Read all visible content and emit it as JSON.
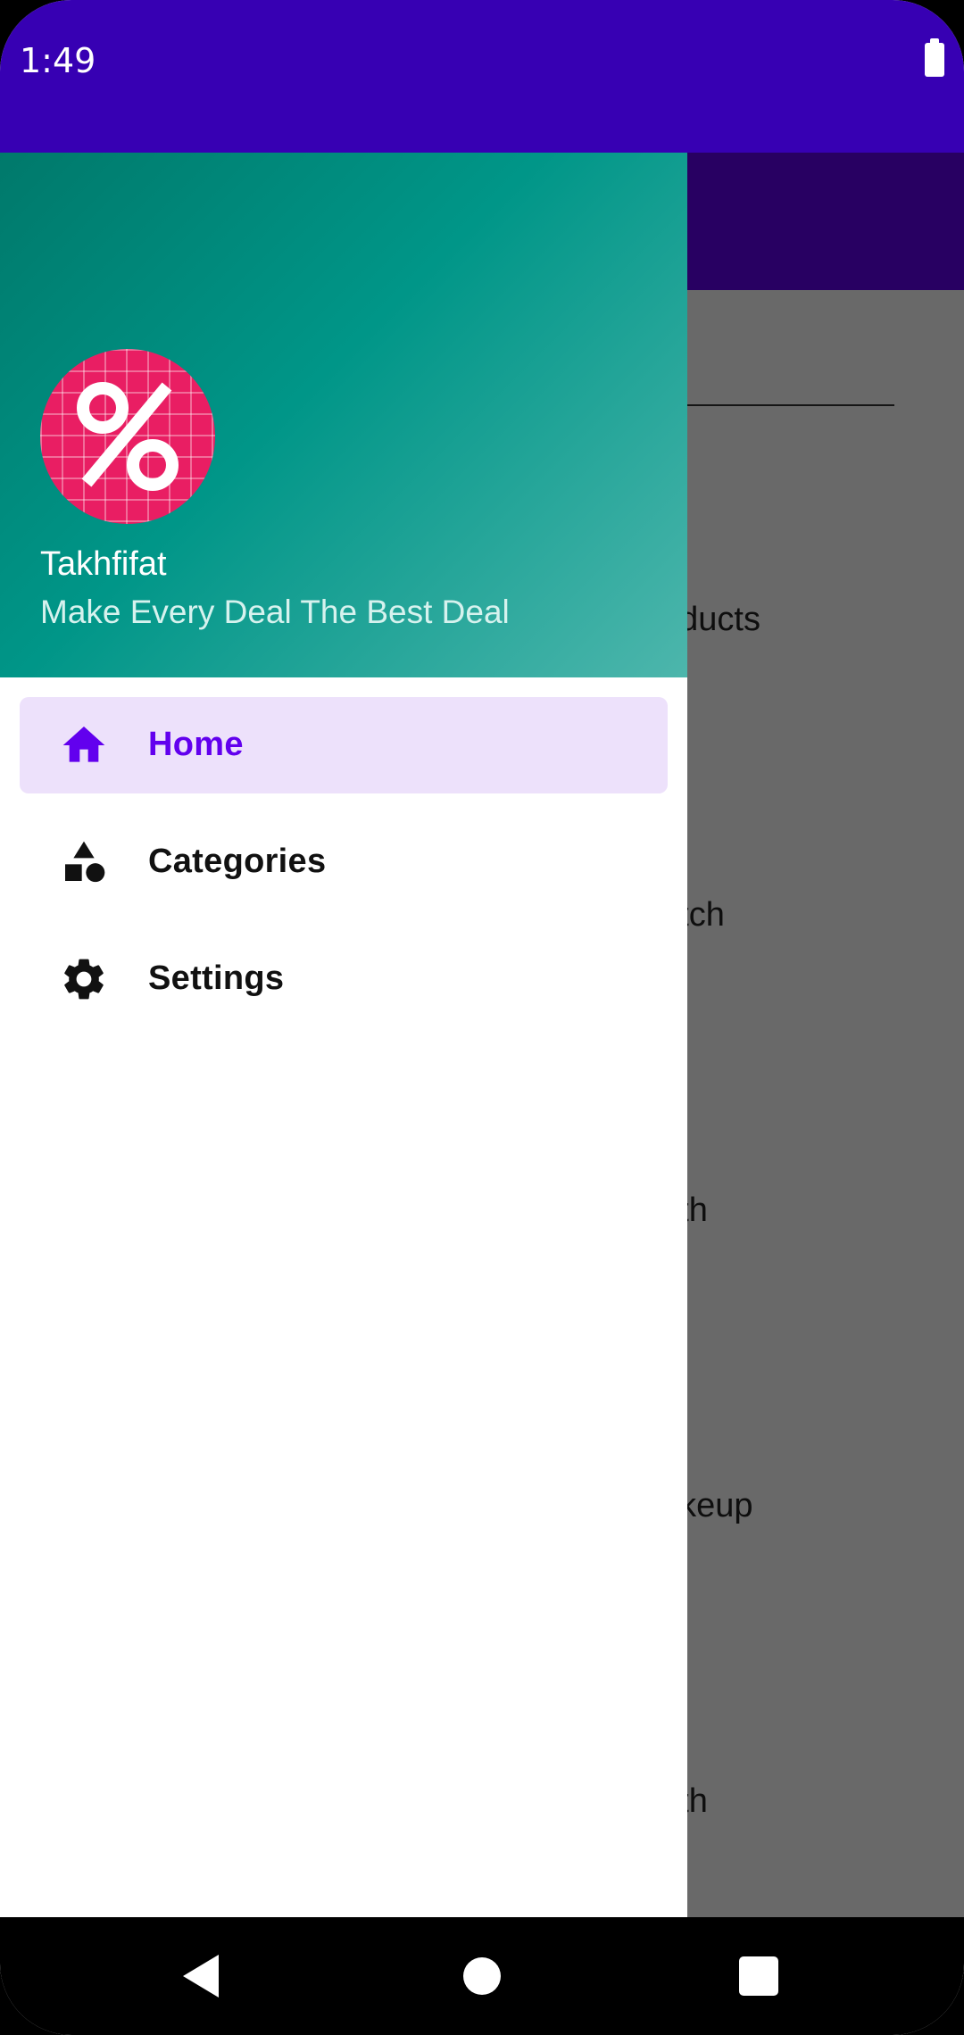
{
  "status_bar": {
    "time": "1:49",
    "battery_icon": "battery-full-icon"
  },
  "background_screen": {
    "items": [
      "oducts",
      "atch",
      "nth",
      "akeup",
      "nth"
    ]
  },
  "drawer": {
    "header": {
      "logo_icon": "percent-icon",
      "title": "Takhfifat",
      "subtitle": "Make Every Deal The Best Deal"
    },
    "items": [
      {
        "label": "Home",
        "icon": "home-icon",
        "active": true
      },
      {
        "label": "Categories",
        "icon": "shapes-icon",
        "active": false
      },
      {
        "label": "Settings",
        "icon": "gear-icon",
        "active": false
      }
    ]
  },
  "colors": {
    "status_bar": "#3700B3",
    "accent": "#6200EE",
    "active_item_bg": "#EDE1FB",
    "logo": "#E91E63"
  },
  "nav_bar": {
    "buttons": [
      "back-icon",
      "home-circle-icon",
      "recents-icon"
    ]
  }
}
